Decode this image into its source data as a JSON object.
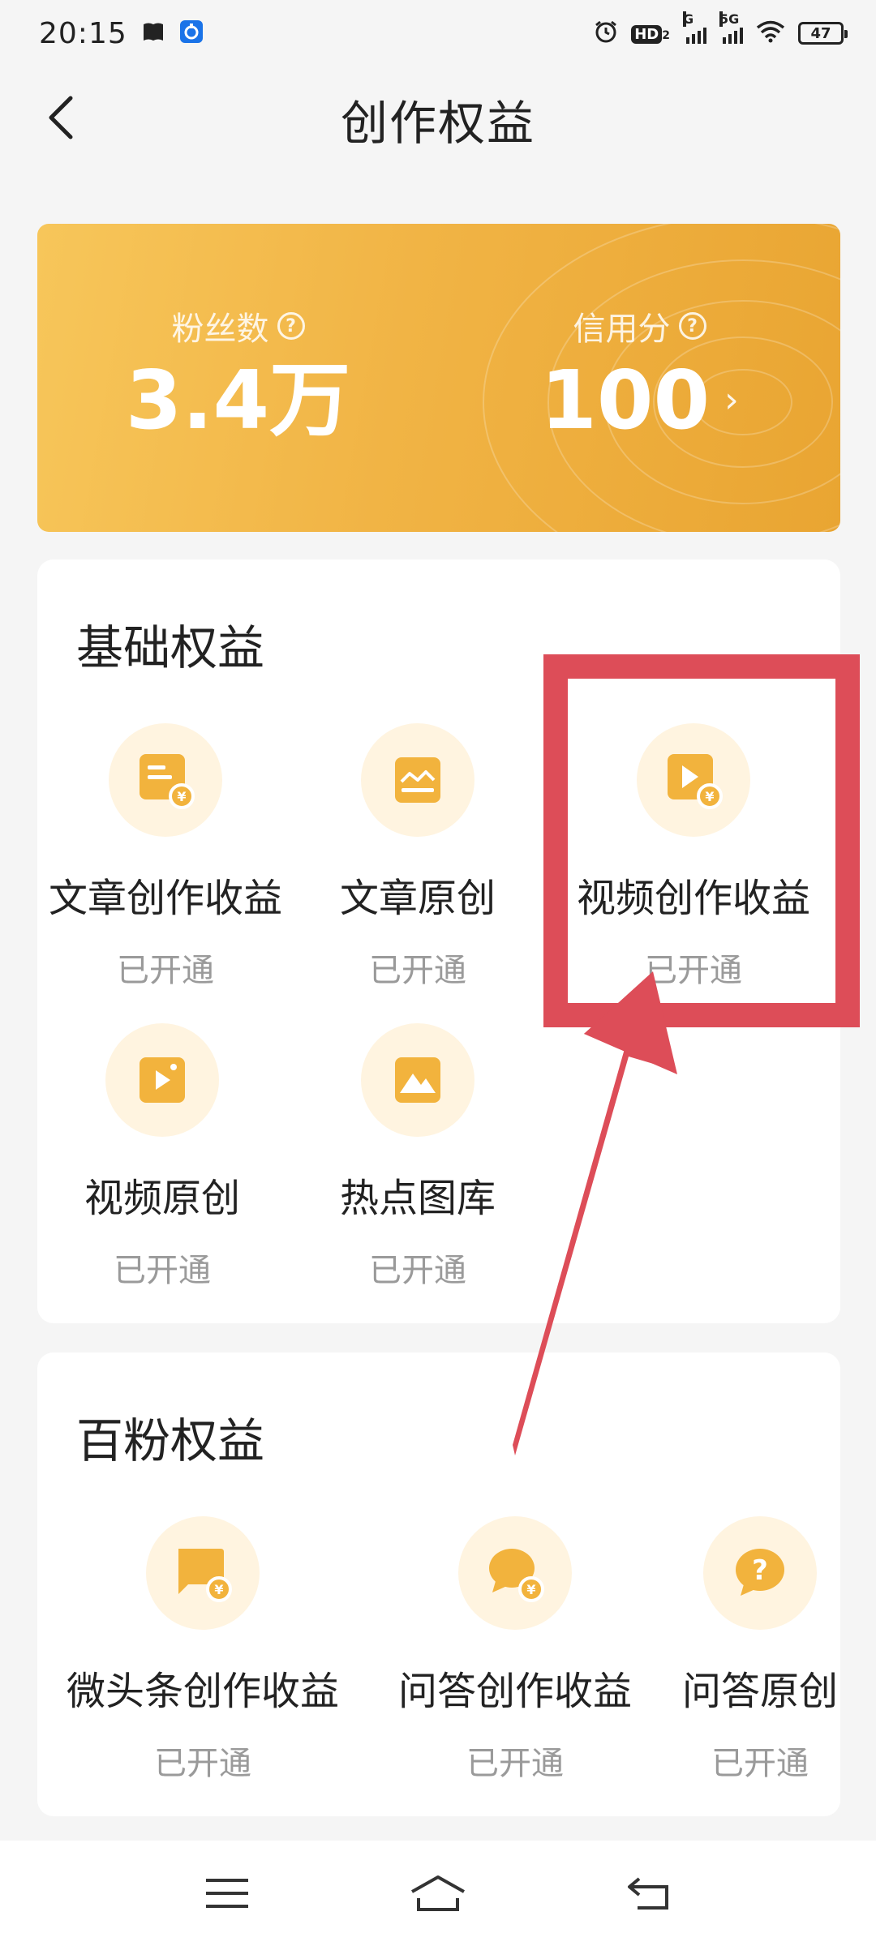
{
  "status_bar": {
    "time": "20:15",
    "network_label_1": "G",
    "network_label_2": "5G",
    "hd_label": "HD",
    "hd_sub": "2",
    "battery": "47"
  },
  "header": {
    "title": "创作权益"
  },
  "stats": {
    "fans_label": "粉丝数",
    "fans_value": "3.4万",
    "credit_label": "信用分",
    "credit_value": "100"
  },
  "basic_benefits": {
    "title": "基础权益",
    "items": [
      {
        "title": "文章创作收益",
        "status": "已开通",
        "icon": "article-yuan-icon"
      },
      {
        "title": "文章原创",
        "status": "已开通",
        "icon": "article-original-icon"
      },
      {
        "title": "视频创作收益",
        "status": "已开通",
        "icon": "video-yuan-icon"
      },
      {
        "title": "视频原创",
        "status": "已开通",
        "icon": "video-original-icon"
      },
      {
        "title": "热点图库",
        "status": "已开通",
        "icon": "hot-gallery-icon"
      }
    ]
  },
  "fans_benefits": {
    "title": "百粉权益",
    "items": [
      {
        "title": "微头条创作收益",
        "status": "已开通",
        "icon": "micro-post-yuan-icon"
      },
      {
        "title": "问答创作收益",
        "status": "已开通",
        "icon": "qa-yuan-icon"
      },
      {
        "title": "问答原创",
        "status": "已开通",
        "icon": "qa-original-icon"
      }
    ]
  },
  "colors": {
    "banner_start": "#f7c65a",
    "banner_end": "#e9a532",
    "icon_bg": "#fff4e0",
    "icon_fill": "#f2b33d",
    "annotation": "#dd4d58"
  }
}
